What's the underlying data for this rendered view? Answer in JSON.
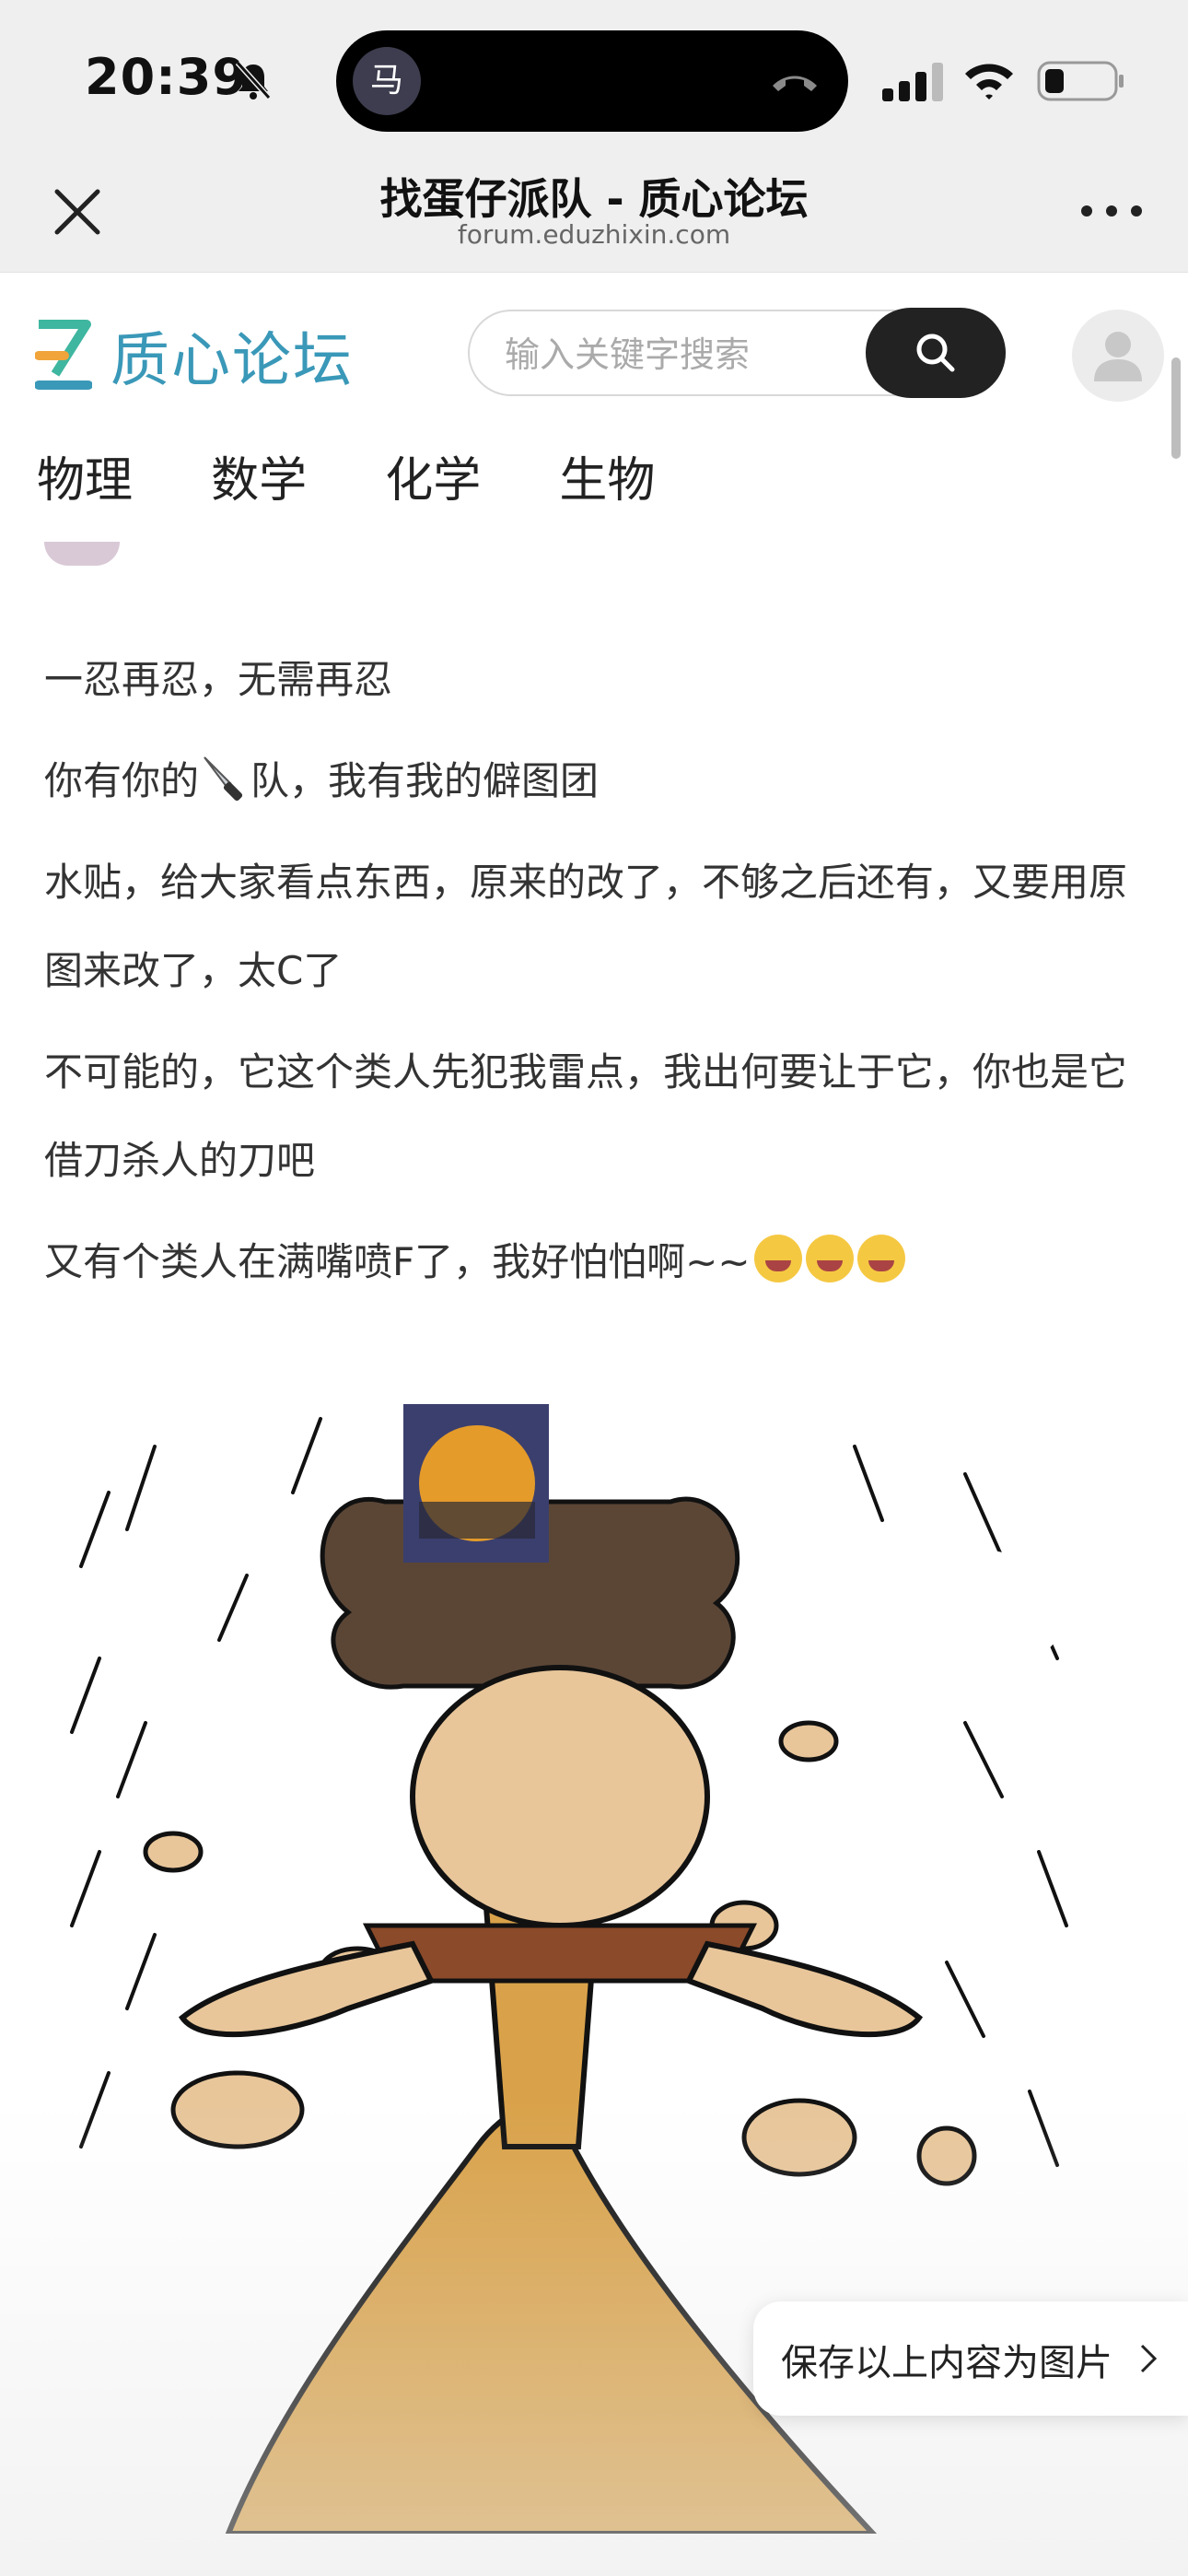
{
  "status_bar": {
    "time": "20:39",
    "island_avatar_char": "马",
    "icons": [
      "bell-muted-icon",
      "phone-end-icon",
      "signal-icon",
      "wifi-icon",
      "battery-icon"
    ]
  },
  "nav": {
    "title": "找蛋仔派队 - 质心论坛",
    "url": "forum.eduzhixin.com",
    "icons": [
      "close-icon",
      "more-icon"
    ]
  },
  "site": {
    "logo_text": "质心论坛",
    "search_placeholder": "输入关键字搜索",
    "tabs": [
      "物理",
      "数学",
      "化学",
      "生物"
    ],
    "accent_color": "#3a98b8"
  },
  "post": {
    "paragraphs": [
      "一忍再忍，无需再忍",
      "你有你的",
      "水贴，给大家看点东西，原来的改了，不够之后还有，又要用原图来改了，太C了",
      "不可能的，它这个类人先犯我雷点，我出何要让于它，你也是它借刀杀人的刀吧",
      "又有个类人在满嘴喷F了，我好怕怕啊~~"
    ],
    "para2_after": "队，我有我的僻图团",
    "save_button_label": "保存以上内容为图片"
  }
}
